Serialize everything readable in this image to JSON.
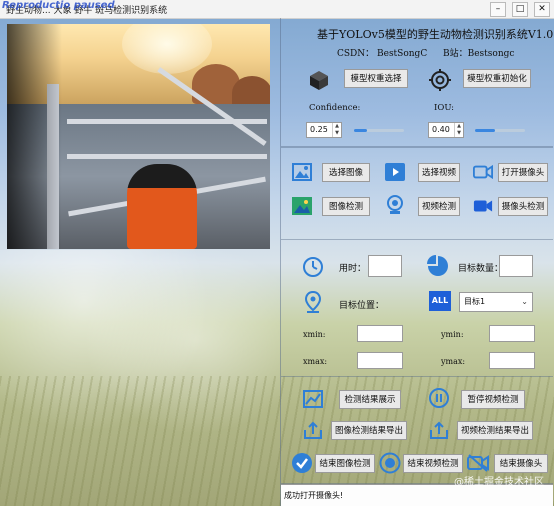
{
  "window": {
    "title": "野生动物... 大象 野牛 斑马检测识别系统",
    "watermark": "Reproductio paused"
  },
  "header": {
    "title": "基于YOLOv5模型的野生动物检测识别系统V1.0",
    "csdn": "CSDN： BestSongC",
    "bili": "B站：Bestsongc"
  },
  "model": {
    "select_weights": "模型权重选择",
    "init_weights": "模型权重初始化",
    "confidence_label": "Confidence:",
    "confidence_value": "0.25",
    "confidence_level": 0.25,
    "iou_label": "IOU:",
    "iou_value": "0.40",
    "iou_level": 0.4
  },
  "source": {
    "select_image": "选择图像",
    "select_video": "选择视频",
    "open_camera": "打开摄像头",
    "image_detect": "图像检测",
    "video_detect": "视频检测",
    "camera_detect": "摄像头检测"
  },
  "info": {
    "time_label": "用时：",
    "count_label": "目标数量：",
    "position_label": "目标位置：",
    "target_select": "目标1",
    "all_badge": "ALL",
    "xmin": "xmin:",
    "ymin": "ymin:",
    "xmax": "xmax:",
    "ymax": "ymax:"
  },
  "actions": {
    "show_results": "检测结果展示",
    "pause_video": "暂停视频检测",
    "export_image": "图像检测结果导出",
    "export_video": "视频检测结果导出",
    "end_image": "结束图像检测",
    "end_video": "结束视频检测",
    "end_camera": "结束摄像头"
  },
  "status": {
    "message": "成功打开摄像头!"
  },
  "corner_watermark": "@稀土掘金技术社区",
  "colors": {
    "accent": "#3a86e0",
    "icon_blue": "#2f7fd6",
    "badge_blue": "#1e5fd8"
  }
}
